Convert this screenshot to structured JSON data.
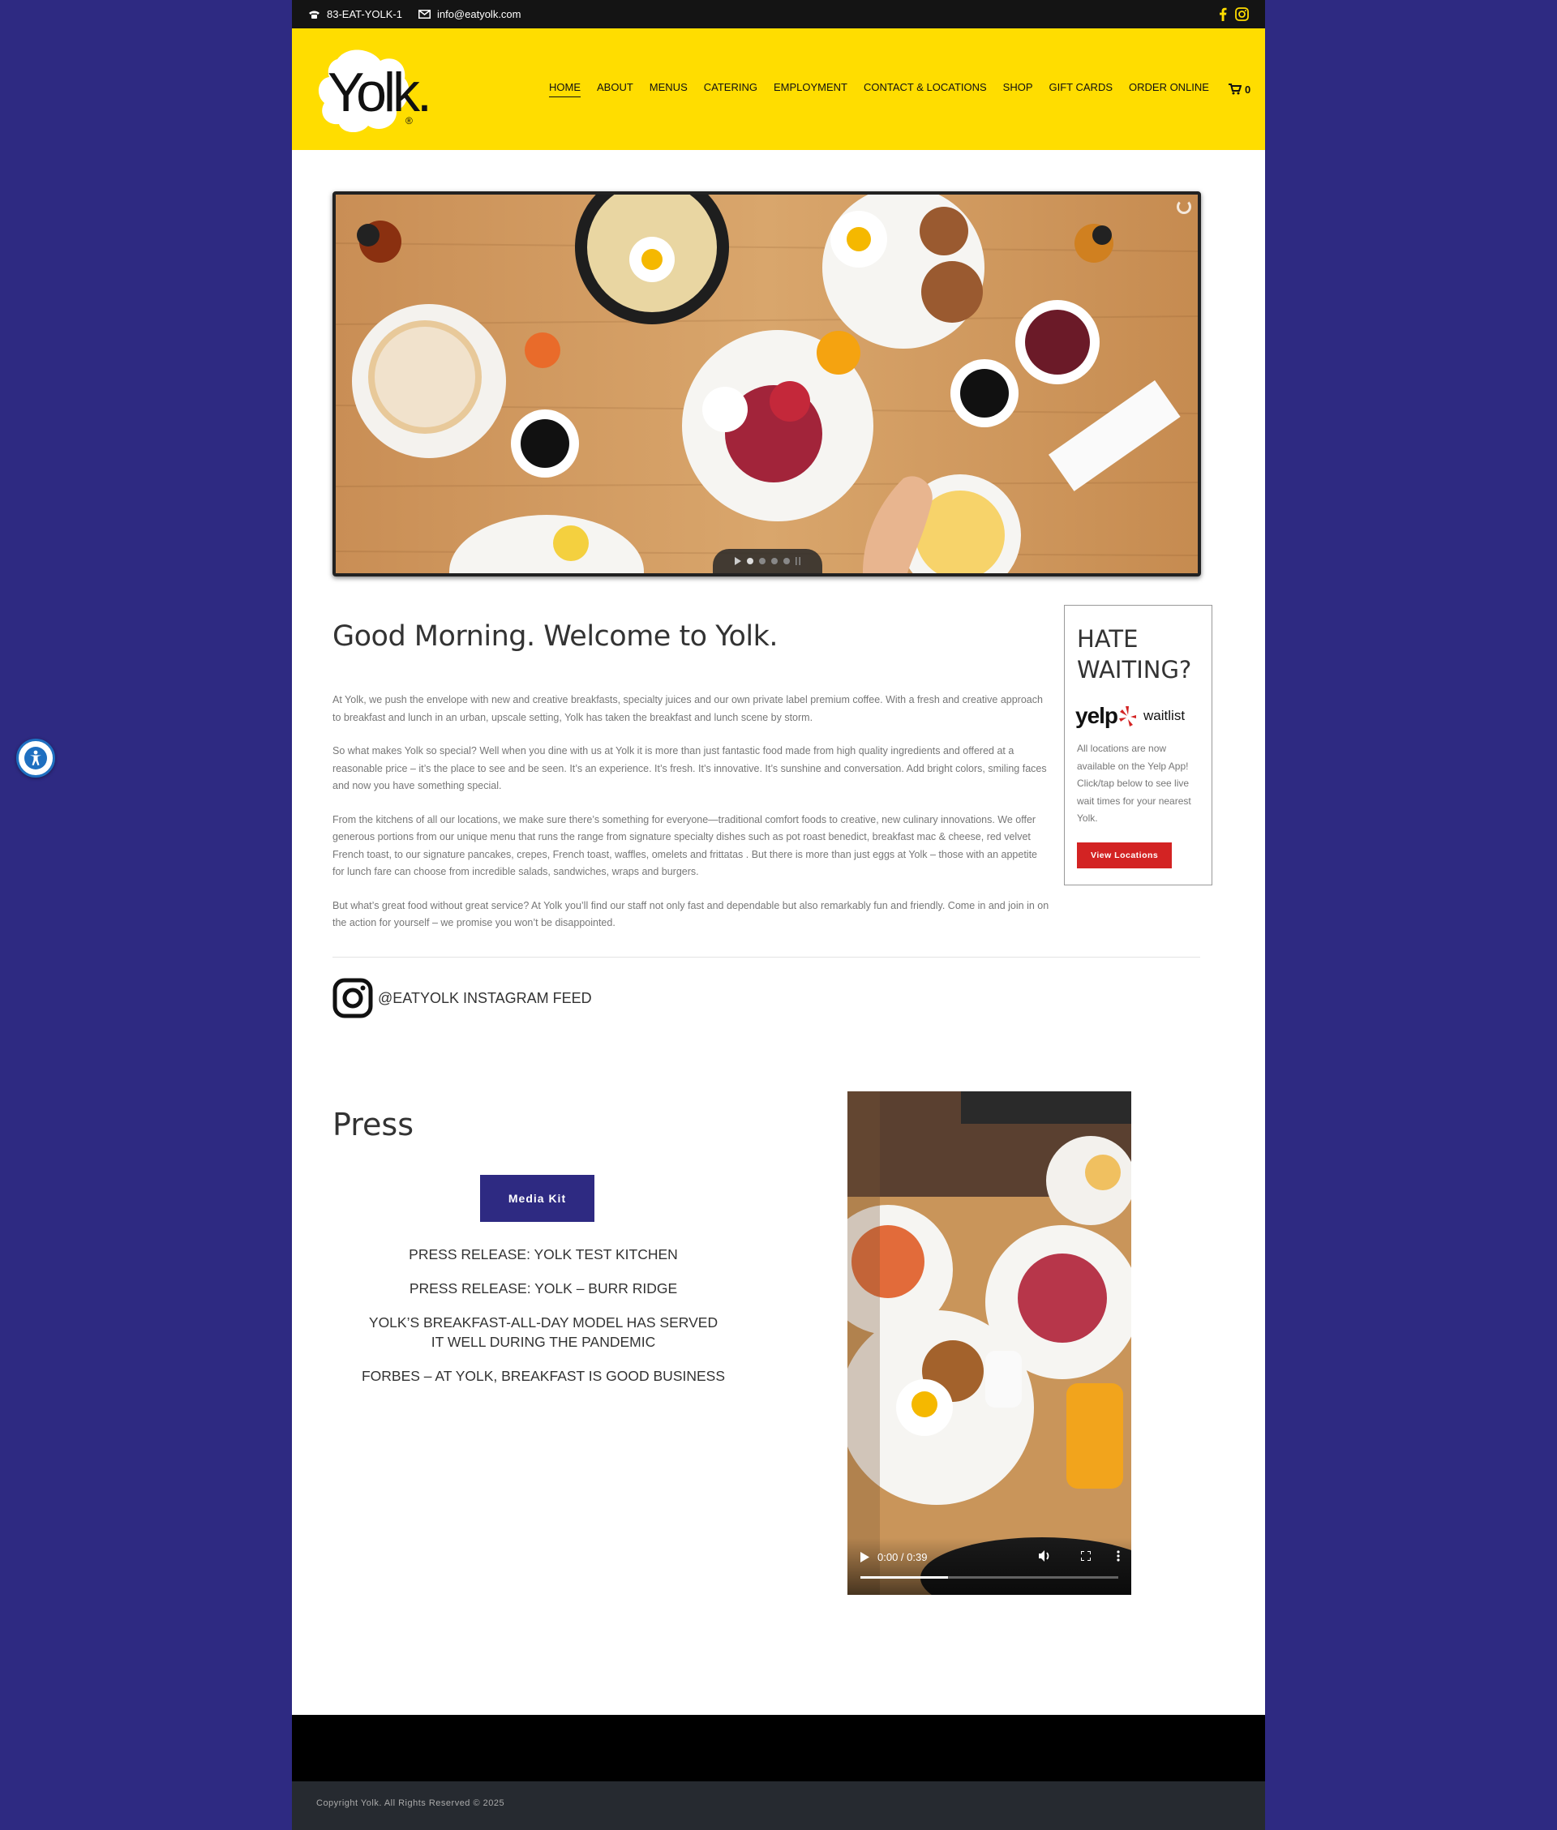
{
  "topbar": {
    "phone": "83-EAT-YOLK-1",
    "email": "info@eatyolk.com",
    "icons": [
      "phone-icon",
      "email-icon",
      "facebook-icon",
      "instagram-icon"
    ]
  },
  "brand": {
    "name": "Yolk.",
    "registered": "®",
    "accent": "#ffdd00",
    "brand_blue": "#2e2a82"
  },
  "nav": {
    "items": [
      "HOME",
      "ABOUT",
      "MENUS",
      "CATERING",
      "EMPLOYMENT",
      "CONTACT & LOCATIONS",
      "SHOP",
      "GIFT CARDS",
      "ORDER ONLINE"
    ],
    "active": "HOME",
    "cart_count": "0"
  },
  "welcome": {
    "title": "Good Morning. Welcome to Yolk.",
    "paragraphs": [
      "At Yolk, we push the envelope with new and creative breakfasts, specialty juices and our own private label premium coffee. With a fresh and creative approach to breakfast and lunch in an urban, upscale setting, Yolk has taken the breakfast and lunch scene by storm.",
      "So what makes Yolk so special? Well when you dine with us at Yolk it is more than just fantastic food made from high quality ingredients and offered at a reasonable price – it’s the place to see and be seen. It’s an experience. It’s fresh. It’s innovative. It’s sunshine and conversation. Add bright colors, smiling faces and now you have something special.",
      "From the kitchens of all our locations, we make sure there’s something for everyone—traditional comfort foods to creative, new culinary innovations. We offer generous portions from our unique menu that runs the range from signature specialty dishes such as pot roast benedict, breakfast mac & cheese, red velvet French toast, to our signature pancakes, crepes, French toast, waffles, omelets and frittatas . But there is more than just eggs at Yolk – those with an appetite for lunch fare can choose from incredible salads, sandwiches, wraps and burgers.",
      "But what’s great food without great service? At Yolk you’ll find our staff not only fast and dependable but also remarkably fun and friendly. Come in and join in on the action for yourself – we promise you won’t be disappointed."
    ]
  },
  "yelp": {
    "title": "HATE WAITING?",
    "logo_word": "yelp",
    "waitlist": "waitlist",
    "text": "All locations are now available on the Yelp App! Click/tap below to see live wait times for your nearest Yolk.",
    "button": "View Locations",
    "button_color": "#d32323"
  },
  "instagram": {
    "label": "@EATYOLK INSTAGRAM FEED"
  },
  "press": {
    "title": "Press",
    "media_kit": "Media Kit",
    "links": [
      "PRESS RELEASE: YOLK TEST KITCHEN",
      "PRESS RELEASE: YOLK – BURR RIDGE",
      "YOLK’S BREAKFAST-ALL-DAY MODEL HAS SERVED IT WELL DURING THE PANDEMIC",
      "FORBES – AT YOLK, BREAKFAST IS GOOD BUSINESS"
    ]
  },
  "video": {
    "time": "0:00 / 0:39",
    "progress": 0.34
  },
  "slider": {
    "slides": 5,
    "active": 1
  },
  "footer": {
    "copyright": "Copyright Yolk. All Rights Reserved © 2025"
  }
}
